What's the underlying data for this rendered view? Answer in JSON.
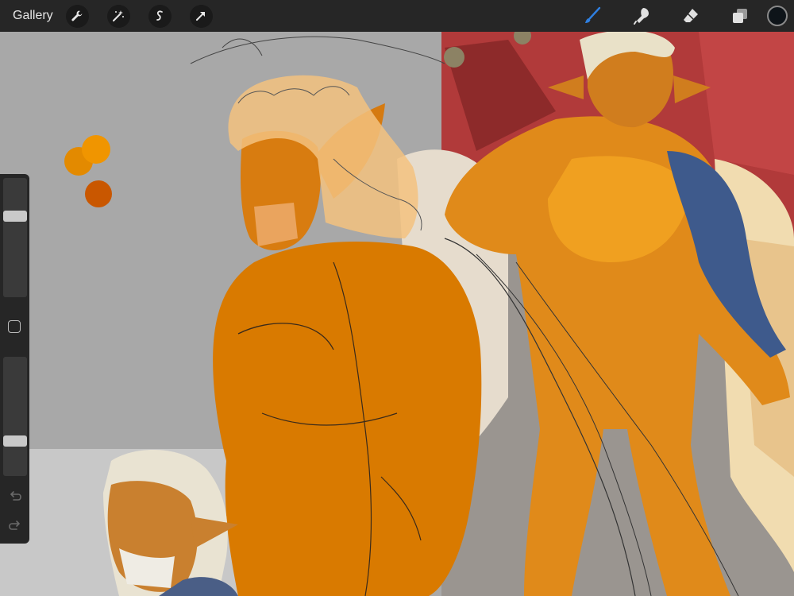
{
  "topbar": {
    "gallery_label": "Gallery",
    "left_tools": [
      "wrench-icon",
      "magic-wand-icon",
      "selection-icon",
      "transform-arrow-icon"
    ],
    "right_tools": [
      "brush-icon",
      "smudge-icon",
      "eraser-icon",
      "layers-icon"
    ],
    "active_tool": "brush",
    "current_color": "#0e1419"
  },
  "sidebar": {
    "brush_size_level": 0.7,
    "opacity_level": 0.27
  },
  "colors": {
    "accent_blue": "#2f7fe0",
    "paint_orange": "#d97a00"
  }
}
